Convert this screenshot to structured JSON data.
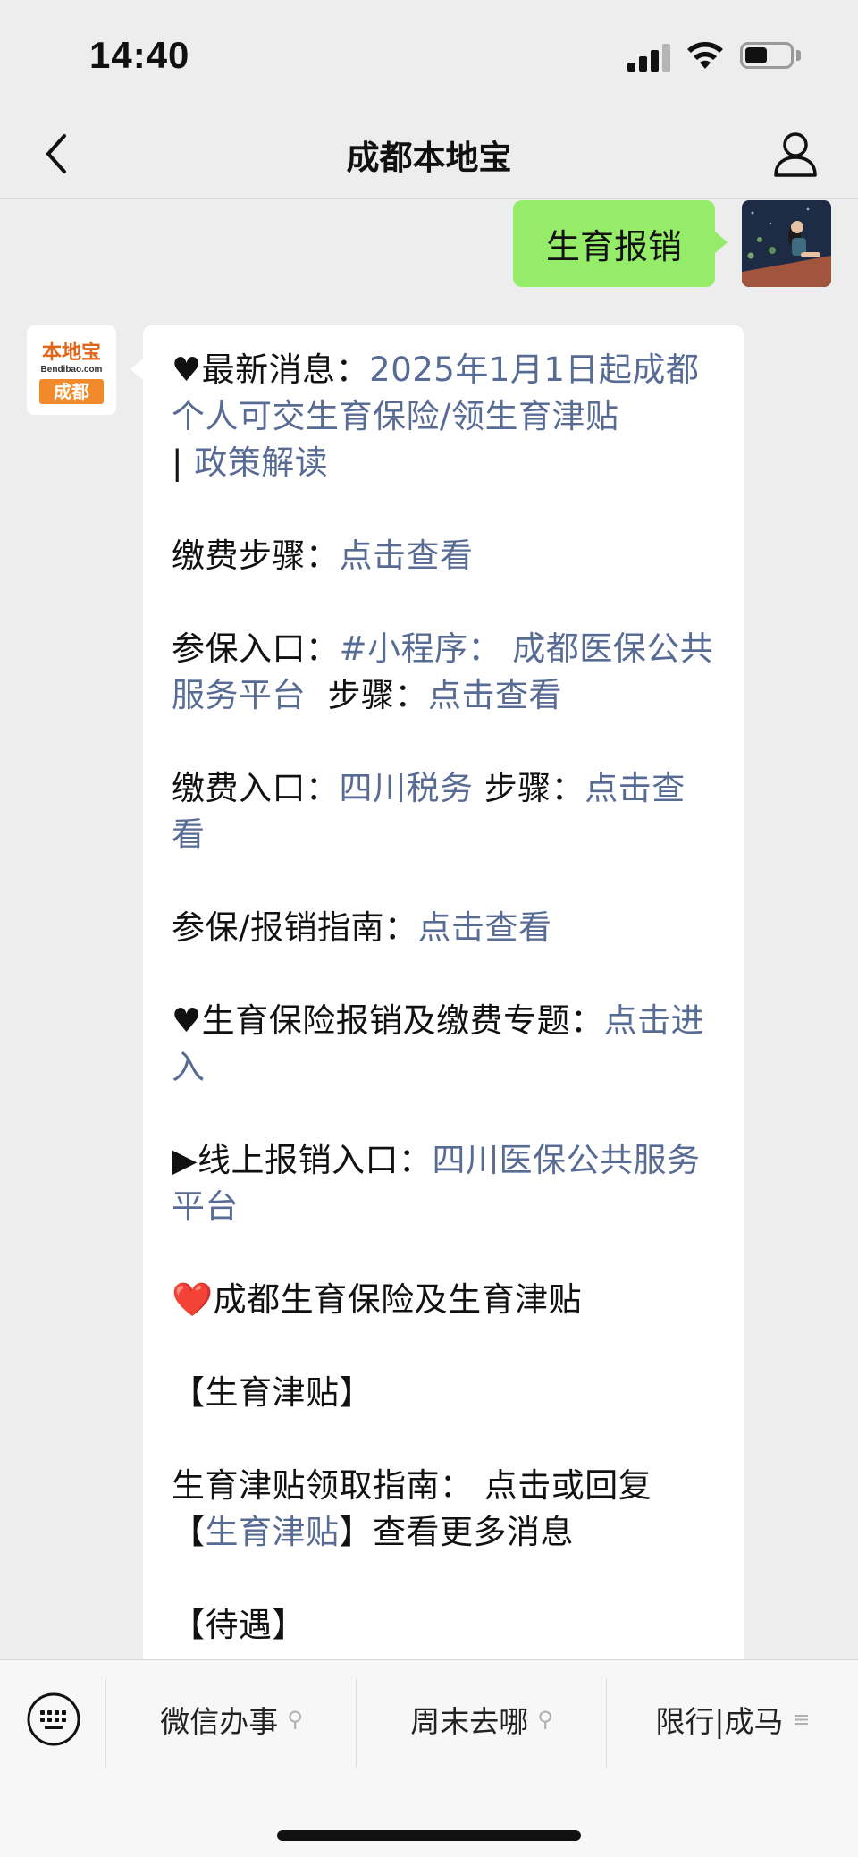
{
  "status_bar": {
    "time": "14:40"
  },
  "nav": {
    "title": "成都本地宝",
    "back_icon": "chevron-left-icon",
    "profile_icon": "person-icon"
  },
  "user_message": {
    "text": "生育报销"
  },
  "bot_logo": {
    "top_text": "本地宝",
    "domain": "Bendibao.com",
    "tag": "成都"
  },
  "bot_message": {
    "l1_prefix": "♥最新消息：",
    "l1_link": "2025年1月1日起成都个人可交生育保险/领生育津贴",
    "l1_sep": "| ",
    "l1_link2": "政策解读",
    "l2_prefix": "缴费步骤：",
    "l2_link": "点击查看",
    "l3_prefix": "参保入口：",
    "l3_link": "#小程序： 成都医保公共服务平台",
    "l3_mid": "步骤：",
    "l3_link2": "点击查看",
    "l4_prefix": "缴费入口：",
    "l4_link": "四川税务",
    "l4_mid": "步骤：",
    "l4_link2": "点击查看",
    "l5_prefix": "参保/报销指南：",
    "l5_link": "点击查看",
    "l6_prefix": "♥生育保险报销及缴费专题：",
    "l6_link": "点击进入",
    "l7_prefix": "▶线上报销入口：",
    "l7_link": "四川医保公共服务平台",
    "l8_heart": "❤️",
    "l8_text": "成都生育保险及生育津贴",
    "l9_text": "【生育津贴】",
    "l10_prefix": "生育津贴领取指南： 点击或回复【",
    "l10_link": "生育津贴",
    "l10_suffix": "】查看更多消息",
    "l11_text": "【待遇】"
  },
  "bottom_menu": {
    "items": [
      {
        "label": "微信办事",
        "glyph": "link-icon"
      },
      {
        "label": "周末去哪",
        "glyph": "link-icon"
      },
      {
        "label": "限行|成马",
        "glyph": "menu-lines-icon"
      }
    ],
    "keyboard_icon": "keyboard-icon"
  },
  "colors": {
    "link": "#576b95",
    "user_bubble": "#95ec69",
    "logo_orange": "#f08a2b"
  }
}
